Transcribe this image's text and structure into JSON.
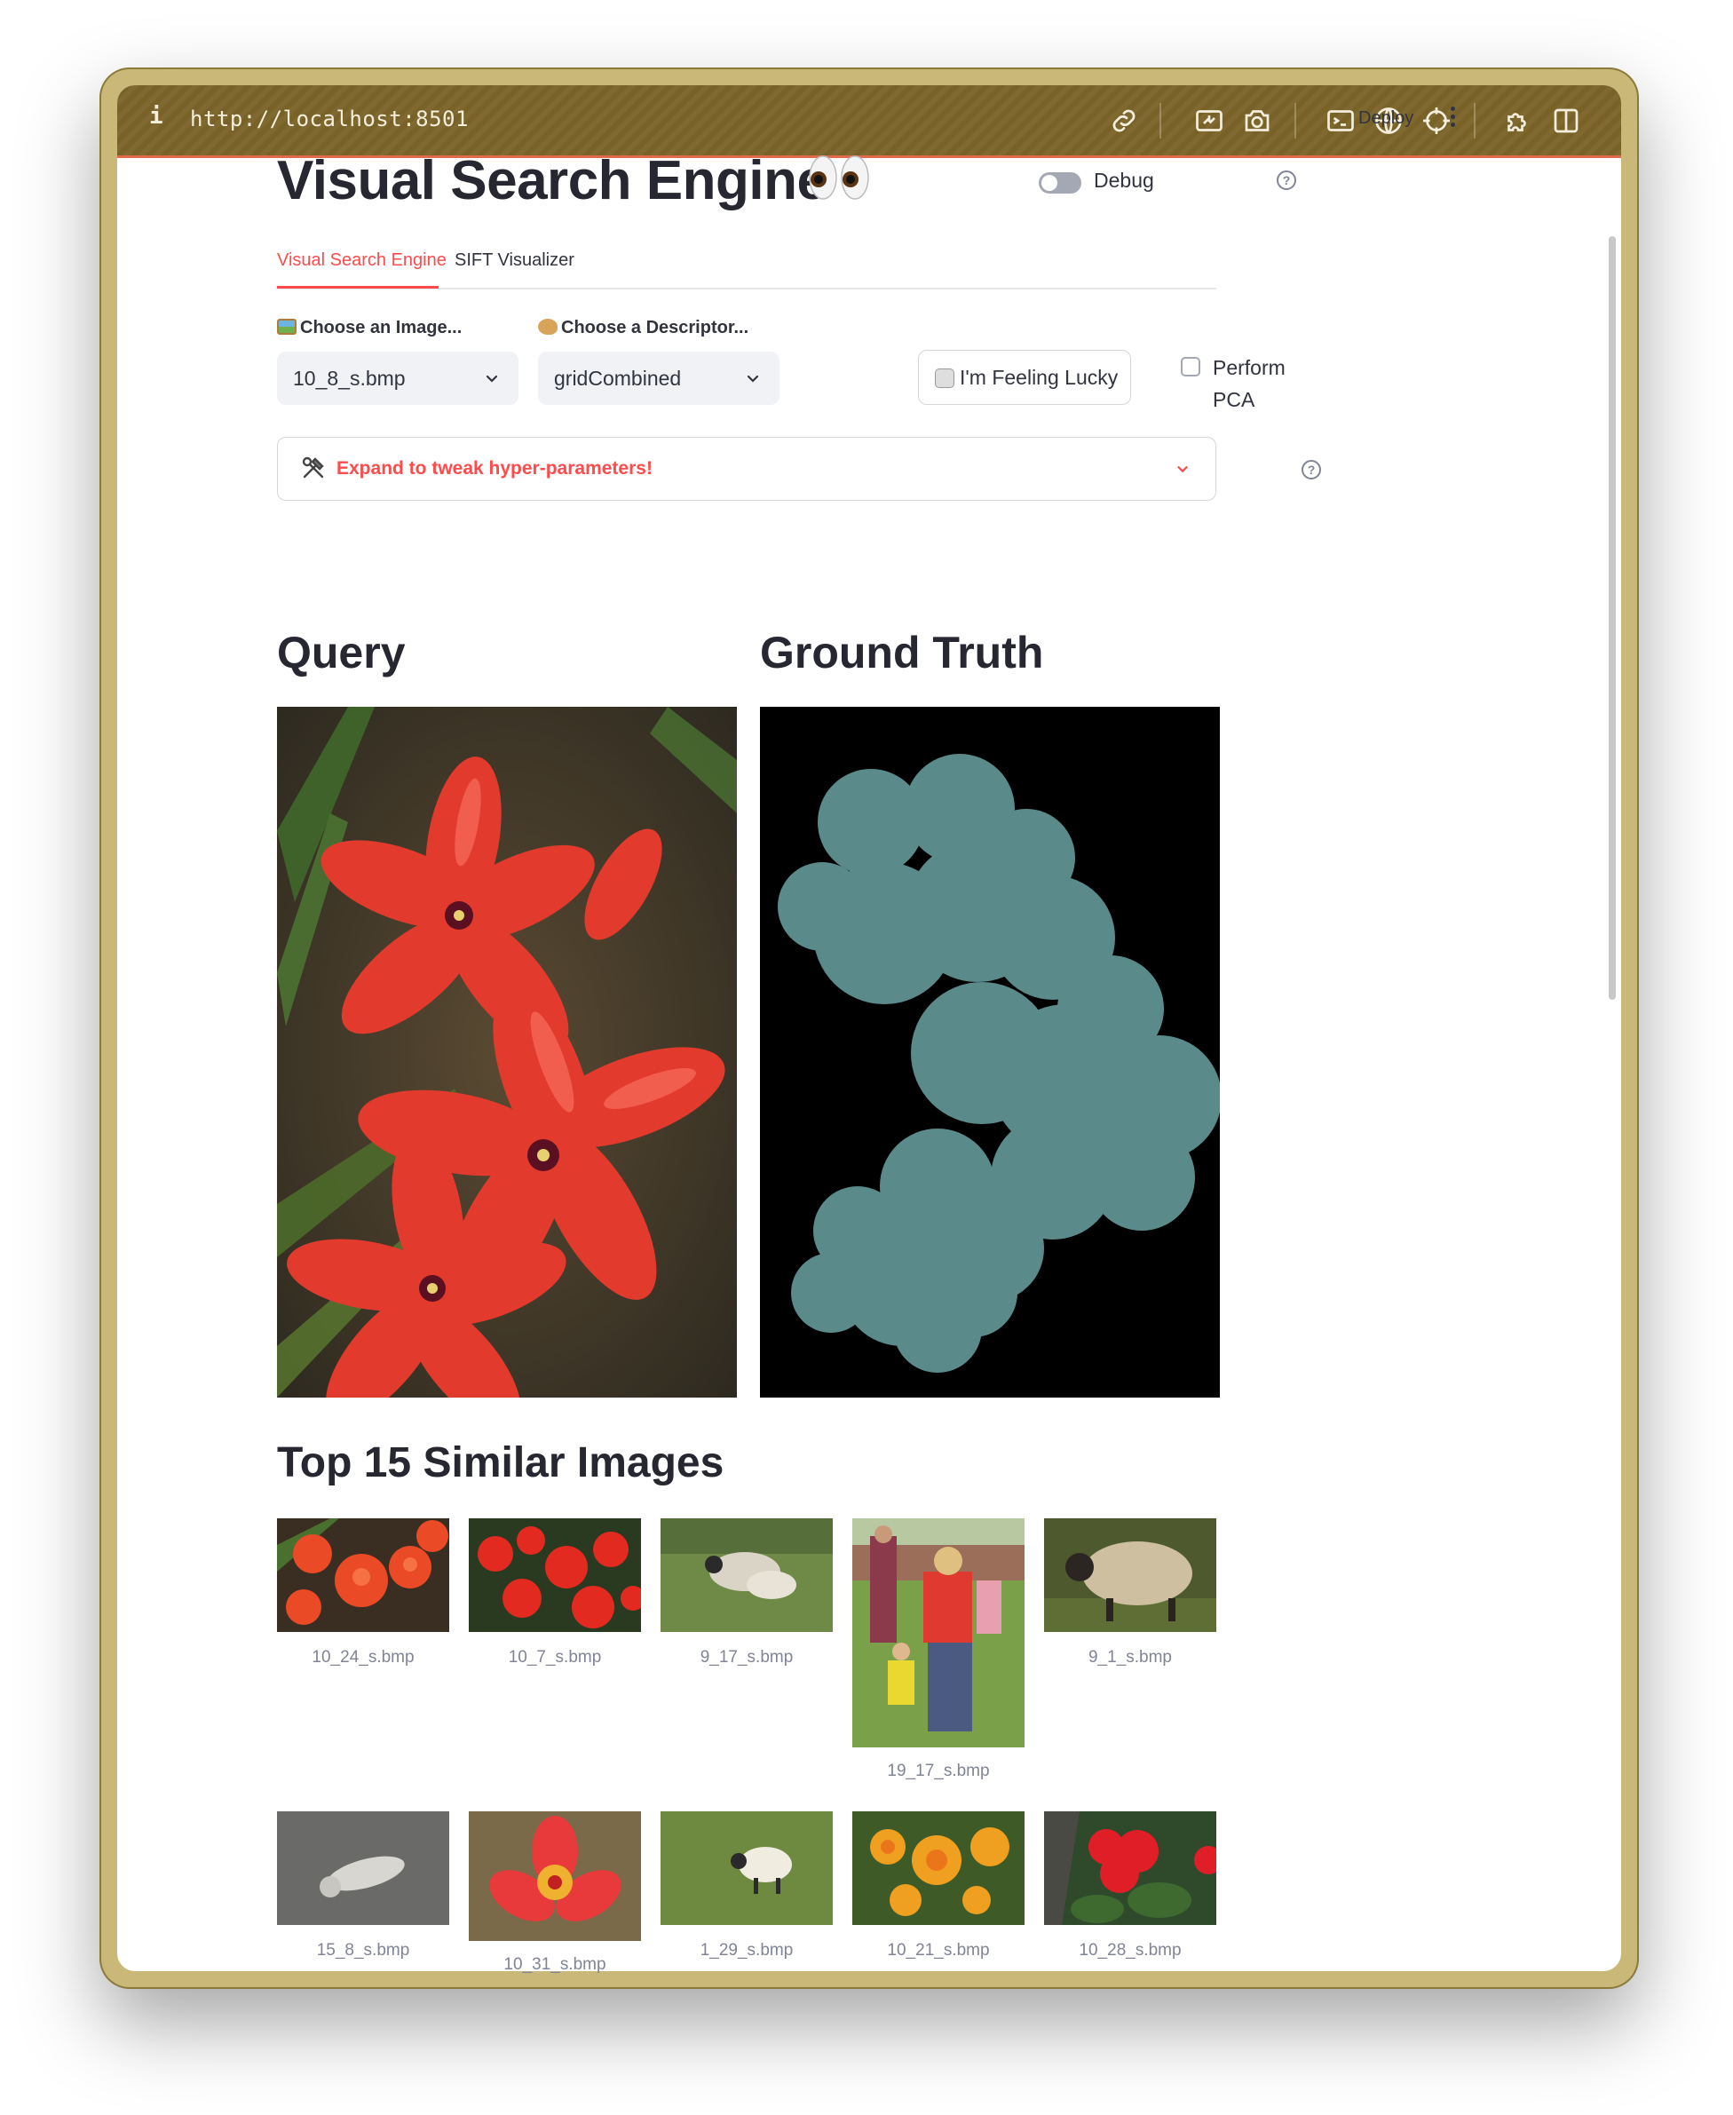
{
  "browser": {
    "info_glyph": "i",
    "url": "http://localhost:8501"
  },
  "header": {
    "deploy_label": "Deploy"
  },
  "page": {
    "title": "Visual Search Engine",
    "title_emoji": "eyes",
    "debug_label": "Debug",
    "debug_enabled": false
  },
  "tabs": [
    {
      "label": "Visual Search Engine",
      "active": true
    },
    {
      "label": "SIFT Visualizer",
      "active": false
    }
  ],
  "controls": {
    "image_label": "Choose an Image...",
    "image_value": "10_8_s.bmp",
    "descriptor_label": "Choose a Descriptor...",
    "descriptor_value": "gridCombined",
    "lucky_label": "I'm Feeling Lucky",
    "pca_label": "Perform PCA",
    "pca_checked": false
  },
  "expander": {
    "label": "Expand to tweak hyper-parameters!"
  },
  "sections": {
    "query": "Query",
    "ground_truth": "Ground Truth",
    "similar": "Top 15 Similar Images"
  },
  "results": [
    {
      "file": "10_24_s.bmp",
      "subject": "red flowers"
    },
    {
      "file": "10_7_s.bmp",
      "subject": "red flowers"
    },
    {
      "file": "9_17_s.bmp",
      "subject": "sheep"
    },
    {
      "file": "19_17_s.bmp",
      "subject": "people"
    },
    {
      "file": "9_1_s.bmp",
      "subject": "sheep"
    },
    {
      "file": "15_8_s.bmp",
      "subject": "cat"
    },
    {
      "file": "10_31_s.bmp",
      "subject": "red flower"
    },
    {
      "file": "1_29_s.bmp",
      "subject": "sheep"
    },
    {
      "file": "10_21_s.bmp",
      "subject": "orange flowers"
    },
    {
      "file": "10_28_s.bmp",
      "subject": "red flowers"
    }
  ],
  "colors": {
    "accent": "#ff4b4b",
    "toolbar": "#7b6428",
    "mask_fill": "#5b8a8a",
    "text": "#31333f"
  }
}
